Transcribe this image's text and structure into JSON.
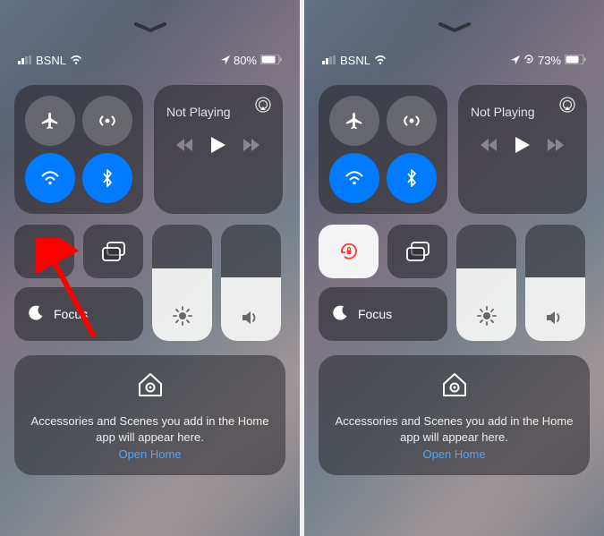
{
  "screens": [
    {
      "status": {
        "carrier": "BSNL",
        "battery": "80%"
      },
      "media": {
        "title": "Not Playing"
      },
      "focus_label": "Focus",
      "brightness_fill_pct": 62,
      "volume_fill_pct": 55,
      "orientation_lock_active": false,
      "home": {
        "text": "Accessories and Scenes you add in the Home app will appear here.",
        "link": "Open Home"
      },
      "has_arrow_annotation": true
    },
    {
      "status": {
        "carrier": "BSNL",
        "battery": "73%"
      },
      "media": {
        "title": "Not Playing"
      },
      "focus_label": "Focus",
      "brightness_fill_pct": 62,
      "volume_fill_pct": 55,
      "orientation_lock_active": true,
      "home": {
        "text": "Accessories and Scenes you add in the Home app will appear here.",
        "link": "Open Home"
      },
      "has_arrow_annotation": false
    }
  ]
}
